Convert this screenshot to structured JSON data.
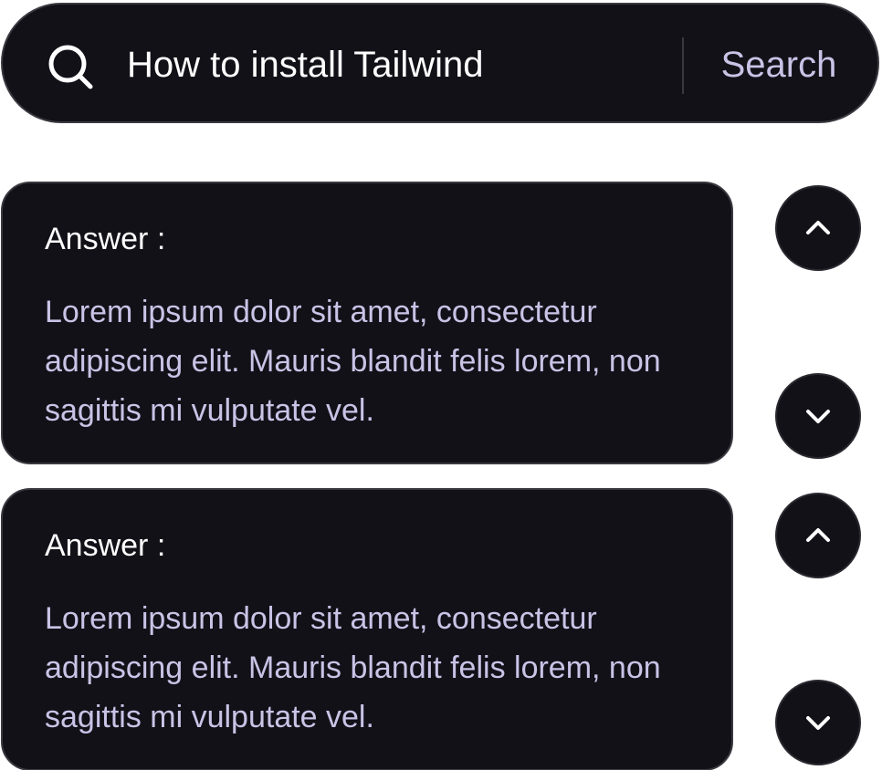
{
  "search": {
    "query": "How to install Tailwind",
    "button_label": "Search",
    "icon": "search-icon"
  },
  "answers": [
    {
      "title": "Answer :",
      "body": "Lorem ipsum dolor sit amet, consectetur adipiscing elit. Mauris blandit felis lorem, non sagittis mi vulputate vel.",
      "upvote_icon": "chevron-up-icon",
      "downvote_icon": "chevron-down-icon"
    },
    {
      "title": "Answer :",
      "body": "Lorem ipsum dolor sit amet, consectetur adipiscing elit. Mauris blandit felis lorem, non sagittis mi vulputate vel.",
      "upvote_icon": "chevron-up-icon",
      "downvote_icon": "chevron-down-icon"
    }
  ],
  "colors": {
    "surface": "#121118",
    "border": "#3a3940",
    "text_primary": "#ffffff",
    "text_muted": "#c9c3e6"
  }
}
